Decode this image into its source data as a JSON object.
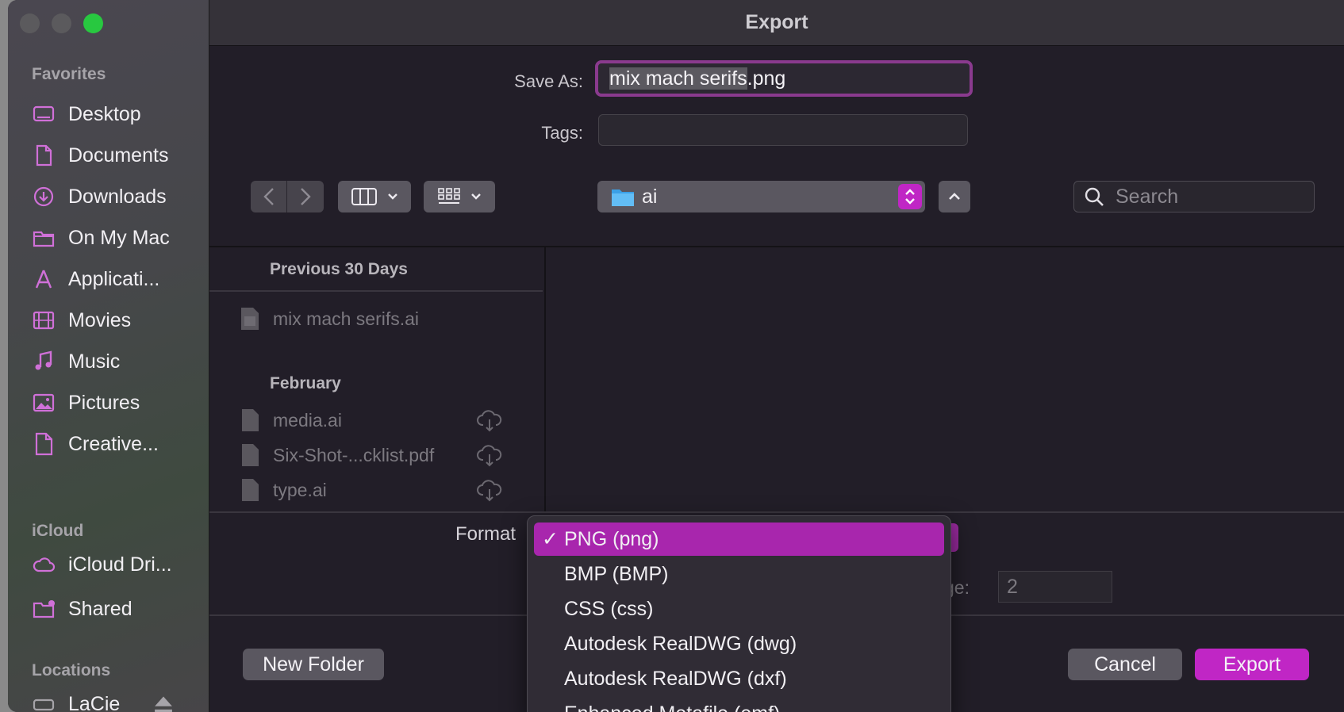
{
  "window": {
    "title": "Export"
  },
  "sidebar": {
    "favorites_label": "Favorites",
    "favorites": [
      {
        "label": "Desktop",
        "icon": "desktop-icon"
      },
      {
        "label": "Documents",
        "icon": "document-icon"
      },
      {
        "label": "Downloads",
        "icon": "download-icon"
      },
      {
        "label": "On My Mac",
        "icon": "folder-icon"
      },
      {
        "label": "Applicati...",
        "icon": "applications-icon"
      },
      {
        "label": "Movies",
        "icon": "film-icon"
      },
      {
        "label": "Music",
        "icon": "music-icon"
      },
      {
        "label": "Pictures",
        "icon": "picture-icon"
      },
      {
        "label": "Creative...",
        "icon": "document-icon"
      }
    ],
    "icloud_label": "iCloud",
    "icloud": [
      {
        "label": "iCloud Dri...",
        "icon": "cloud-icon"
      },
      {
        "label": "Shared",
        "icon": "shared-folder-icon"
      }
    ],
    "locations_label": "Locations",
    "locations": [
      {
        "label": "LaCie",
        "icon": "drive-icon"
      }
    ],
    "accent_color": "#d070d8"
  },
  "form": {
    "save_as_label": "Save As:",
    "save_as_selected": "mix mach serifs",
    "save_as_ext": ".png",
    "tags_label": "Tags:",
    "tags_value": ""
  },
  "toolbar": {
    "location": "ai",
    "search_placeholder": "Search"
  },
  "browser": {
    "group1_title": "Previous 30 Days",
    "group1_files": [
      {
        "name": "mix mach serifs.ai"
      }
    ],
    "group2_title": "February",
    "group2_files": [
      {
        "name": "media.ai"
      },
      {
        "name": "Six-Shot-...cklist.pdf"
      },
      {
        "name": "type.ai"
      }
    ]
  },
  "options": {
    "format_label": "Format",
    "page_label": "ge:",
    "page_value": "2"
  },
  "format_menu": {
    "items": [
      {
        "label": "PNG (png)",
        "selected": true
      },
      {
        "label": "BMP (BMP)"
      },
      {
        "label": "CSS (css)"
      },
      {
        "label": "Autodesk RealDWG (dwg)"
      },
      {
        "label": "Autodesk RealDWG (dxf)"
      },
      {
        "label": "Enhanced Metafile (emf)"
      }
    ],
    "check": "✓"
  },
  "buttons": {
    "new_folder": "New Folder",
    "cancel": "Cancel",
    "export": "Export"
  },
  "colors": {
    "accent": "#c026c5",
    "background": "#221e28"
  }
}
